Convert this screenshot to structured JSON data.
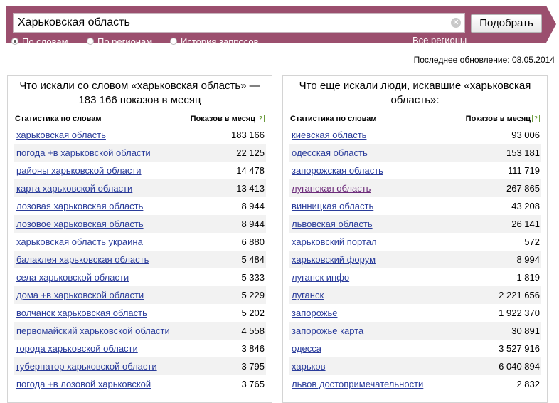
{
  "search": {
    "query": "Харьковская область",
    "submit_label": "Подобрать",
    "modes": [
      {
        "label": "По словам",
        "selected": true
      },
      {
        "label": "По регионам",
        "selected": false
      },
      {
        "label": "История запросов",
        "selected": false
      }
    ],
    "regions_link": "Все регионы"
  },
  "updated": "Последнее обновление: 08.05.2014",
  "left": {
    "title": "Что искали со словом «харьковская область» — 183 166 показов в месяц",
    "col1": "Статистика по словам",
    "col2": "Показов в месяц",
    "rows": [
      {
        "q": "харьковская область",
        "n": "183 166"
      },
      {
        "q": "погода +в харьковской области",
        "n": "22 125"
      },
      {
        "q": "районы харьковской области",
        "n": "14 478"
      },
      {
        "q": "карта харьковской области",
        "n": "13 413"
      },
      {
        "q": "лозовая харьковская область",
        "n": "8 944"
      },
      {
        "q": "лозовое харьковская область",
        "n": "8 944"
      },
      {
        "q": "харьковская область украина",
        "n": "6 880"
      },
      {
        "q": "балаклея харьковская область",
        "n": "5 484"
      },
      {
        "q": "села харьковской области",
        "n": "5 333"
      },
      {
        "q": "дома +в харьковской области",
        "n": "5 229"
      },
      {
        "q": "волчанск харьковская область",
        "n": "5 202"
      },
      {
        "q": "первомайский харьковской области",
        "n": "4 558"
      },
      {
        "q": "города харьковской области",
        "n": "3 846"
      },
      {
        "q": "губернатор харьковской области",
        "n": "3 795"
      },
      {
        "q": "погода +в лозовой харьковской",
        "n": "3 765"
      }
    ]
  },
  "right": {
    "title": "Что еще искали люди, искавшие «харьковская область»:",
    "col1": "Статистика по словам",
    "col2": "Показов в месяц",
    "rows": [
      {
        "q": "киевская область",
        "n": "93 006"
      },
      {
        "q": "одесская область",
        "n": "153 181"
      },
      {
        "q": "запорожская область",
        "n": "111 719"
      },
      {
        "q": "луганская область",
        "n": "267 865",
        "visited": true
      },
      {
        "q": "винницкая область",
        "n": "43 208"
      },
      {
        "q": "львовская область",
        "n": "26 141"
      },
      {
        "q": "харьковский портал",
        "n": "572"
      },
      {
        "q": "харьковский форум",
        "n": "8 994"
      },
      {
        "q": "луганск инфо",
        "n": "1 819"
      },
      {
        "q": "луганск",
        "n": "2 221 656"
      },
      {
        "q": "запорожье",
        "n": "1 922 370"
      },
      {
        "q": "запорожье карта",
        "n": "30 891"
      },
      {
        "q": "одесса",
        "n": "3 527 916"
      },
      {
        "q": "харьков",
        "n": "6 040 894"
      },
      {
        "q": "львов достопримечательности",
        "n": "2 832"
      }
    ]
  }
}
